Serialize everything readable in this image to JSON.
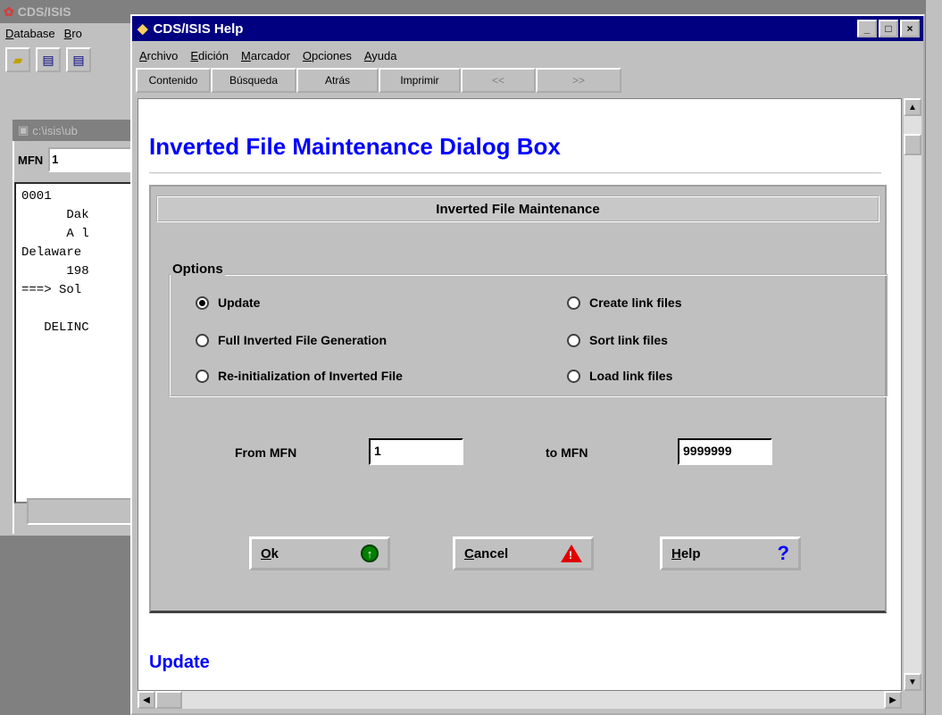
{
  "background_app": {
    "title": "CDS/ISIS",
    "menu": [
      "Database",
      "Bro"
    ],
    "doc_title": "c:\\isis\\ub",
    "mfn_label": "MFN",
    "mfn_value": "1",
    "record_text": "0001\n      Dak\n      A l\nDelaware\n      198\n===> Sol\n\n   DELINC"
  },
  "help_window": {
    "title": "CDS/ISIS Help",
    "title_controls": [
      "_",
      "□",
      "×"
    ],
    "menu": [
      "Archivo",
      "Edición",
      "Marcador",
      "Opciones",
      "Ayuda"
    ],
    "buttons": [
      {
        "label": "Contenido",
        "enabled": true
      },
      {
        "label": "Búsqueda",
        "enabled": true
      },
      {
        "label": "Atrás",
        "enabled": true
      },
      {
        "label": "Imprimir",
        "enabled": true
      },
      {
        "label": "<<",
        "enabled": false
      },
      {
        "label": ">>",
        "enabled": false
      }
    ]
  },
  "topic": {
    "heading": "Inverted File Maintenance Dialog Box",
    "section_heading": "Update"
  },
  "dialog": {
    "caption": "Inverted File Maintenance",
    "options_legend": "Options",
    "options": [
      {
        "label": "Update",
        "selected": true
      },
      {
        "label": "Full Inverted File Generation",
        "selected": false
      },
      {
        "label": "Re-initialization of Inverted File",
        "selected": false
      },
      {
        "label": "Create link files",
        "selected": false
      },
      {
        "label": "Sort link files",
        "selected": false
      },
      {
        "label": "Load link files",
        "selected": false
      }
    ],
    "from_label": "From MFN",
    "from_value": "1",
    "to_label": "to MFN",
    "to_value": "9999999",
    "ok_label": "Ok",
    "cancel_label": "Cancel",
    "help_label": "Help"
  }
}
